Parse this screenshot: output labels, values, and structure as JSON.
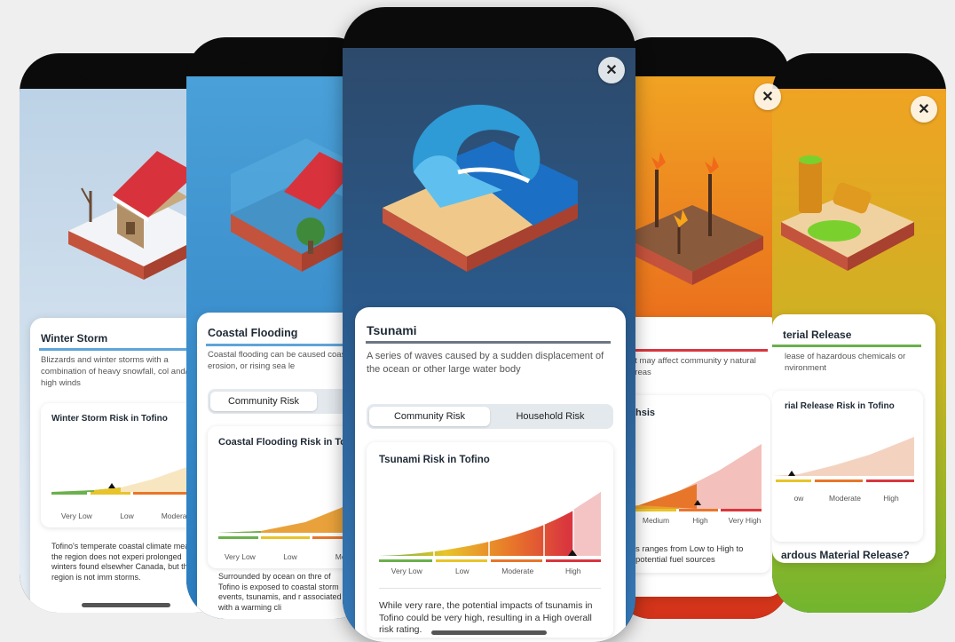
{
  "winter": {
    "title": "Winter Storm",
    "desc": "Blizzards and winter storms with a combination of heavy snowfall, col and/or high winds",
    "risk_title": "Winter Storm Risk in Tofino",
    "levels": [
      "Very Low",
      "Low",
      "Moderate"
    ],
    "note": "Tofino's temperate coastal climate means the region does not experi prolonged winters found elsewher Canada, but the region is not imm storms."
  },
  "coastal": {
    "title": "Coastal Flooding",
    "desc": "Coastal flooding can be caused coastal erosion, or rising sea le",
    "tab1": "Community Risk",
    "risk_title": "Coastal Flooding Risk in To",
    "levels": [
      "Very Low",
      "Low",
      "Mo"
    ],
    "note": "Surrounded by ocean on thre of Tofino is exposed to coastal storm events, tsunamis, and r associated with a warming cli"
  },
  "tsunami": {
    "close_symbol": "✕",
    "title": "Tsunami",
    "desc": "A series of waves caused by a sudden displacement of the ocean or other large water body",
    "tab_community": "Community Risk",
    "tab_household": "Household Risk",
    "risk_title": "Tsunami Risk in Tofino",
    "levels": [
      "Very Low",
      "Low",
      "Moderate",
      "High"
    ],
    "current_level": "High",
    "note": "While very rare, the potential impacts of tsunamis in Tofino could be very high, resulting in a High overall risk rating."
  },
  "wildfire": {
    "close_symbol": "✕",
    "desc": "at may affect community y natural areas",
    "risk_title": "hsis",
    "levels": [
      "Medium",
      "High",
      "Very High"
    ],
    "current_level": "High",
    "note": "s ranges from Low to High to potential fuel sources"
  },
  "hazmat": {
    "close_symbol": "✕",
    "title": "terial Release",
    "desc": "lease of hazardous chemicals or nvironment",
    "risk_title": "rial Release Risk in Tofino",
    "levels": [
      "ow",
      "Moderate",
      "High"
    ],
    "footer": "ardous Material Release?"
  },
  "colors": {
    "very_low": "#6ab04c",
    "low": "#e8c42a",
    "moderate": "#e8762a",
    "high": "#d9363e",
    "tsunami_bg": "#2a5a8c",
    "wildfire_bg": "#e8591a",
    "hazmat_bg": "#9bbf2a"
  }
}
